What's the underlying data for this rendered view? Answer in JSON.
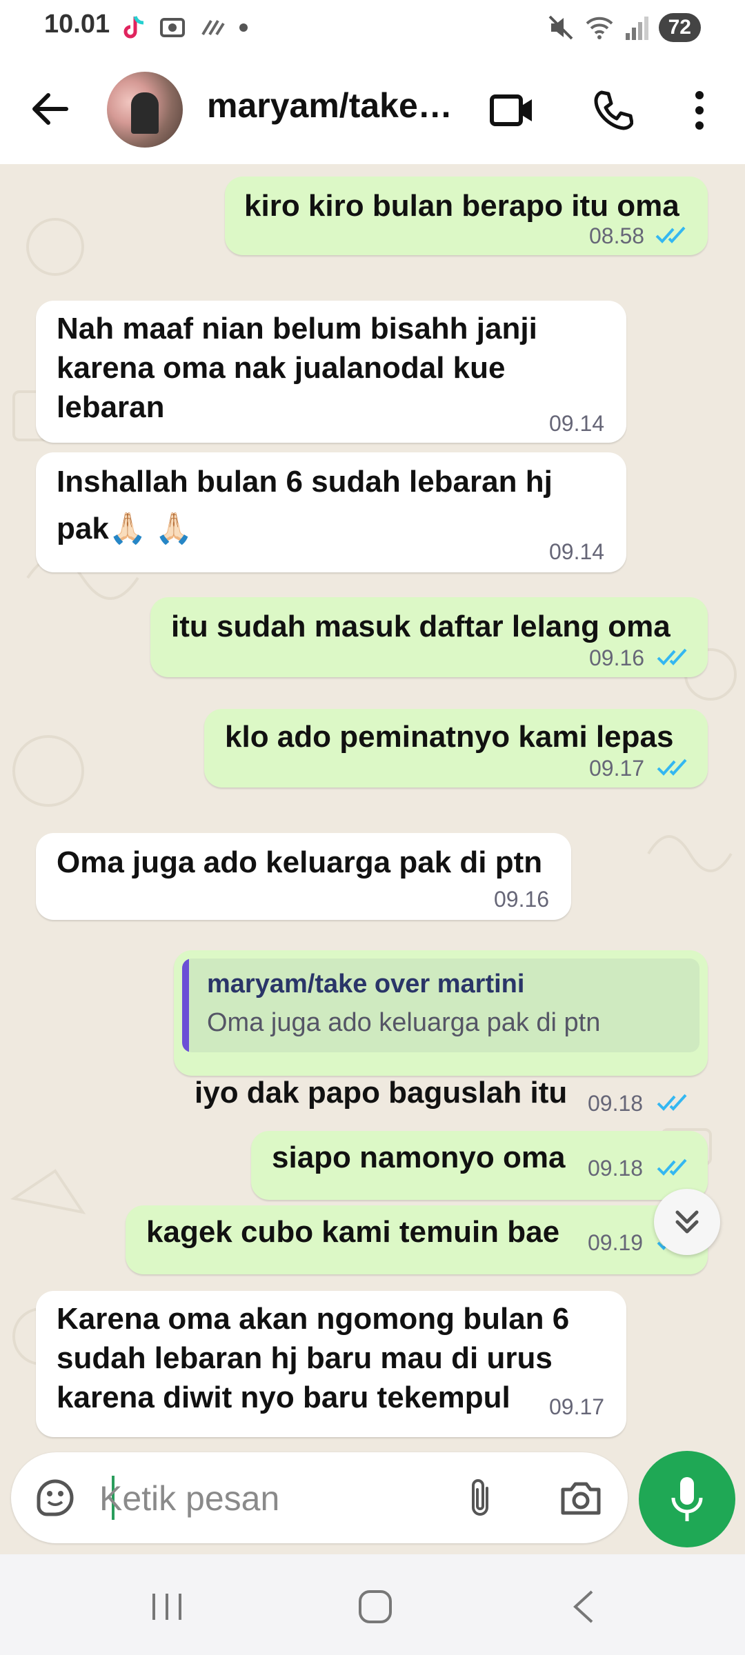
{
  "status_bar": {
    "time": "10.01",
    "battery": "72"
  },
  "header": {
    "contact_name": "maryam/take over martini"
  },
  "messages": [
    {
      "dir": "out",
      "lines": [
        "kiro kiro bulan berapo itu oma"
      ],
      "time": "08.58"
    },
    {
      "dir": "in",
      "lines": [
        "Nah maaf nian  belum bisahh janji",
        "karena oma nak jualanodal kue",
        "lebaran"
      ],
      "time": "09.14"
    },
    {
      "dir": "in",
      "lines": [
        "Inshallah bulan 6 sudah  lebaran hj",
        "pak🙏🏻 🙏🏻"
      ],
      "time": "09.14"
    },
    {
      "dir": "out",
      "lines": [
        "itu sudah masuk daftar lelang oma"
      ],
      "time": "09.16"
    },
    {
      "dir": "out",
      "lines": [
        "klo ado peminatnyo kami lepas"
      ],
      "time": "09.17"
    },
    {
      "dir": "in",
      "lines": [
        "Oma juga ado keluarga pak di ptn"
      ],
      "time": "09.16"
    },
    {
      "dir": "out",
      "quote_name": "maryam/take over martini",
      "quote_text": "Oma juga ado keluarga pak di ptn",
      "lines": [
        "iyo dak papo baguslah itu"
      ],
      "time": "09.18"
    },
    {
      "dir": "out",
      "lines": [
        "siapo namonyo oma"
      ],
      "time": "09.18"
    },
    {
      "dir": "out",
      "lines": [
        "kagek cubo kami temuin bae"
      ],
      "time": "09.19"
    },
    {
      "dir": "in",
      "lines": [
        "Karena oma akan ngomong bulan  6",
        "sudah lebaran hj baru mau di urus",
        "karena diwit nyo baru tekempul"
      ],
      "time": "09.17"
    }
  ],
  "input": {
    "placeholder": "Ketik pesan"
  },
  "colors": {
    "outgoing": "#dcf8c6",
    "incoming": "#ffffff",
    "read_ticks": "#34b7f1",
    "accent": "#1fa855"
  }
}
